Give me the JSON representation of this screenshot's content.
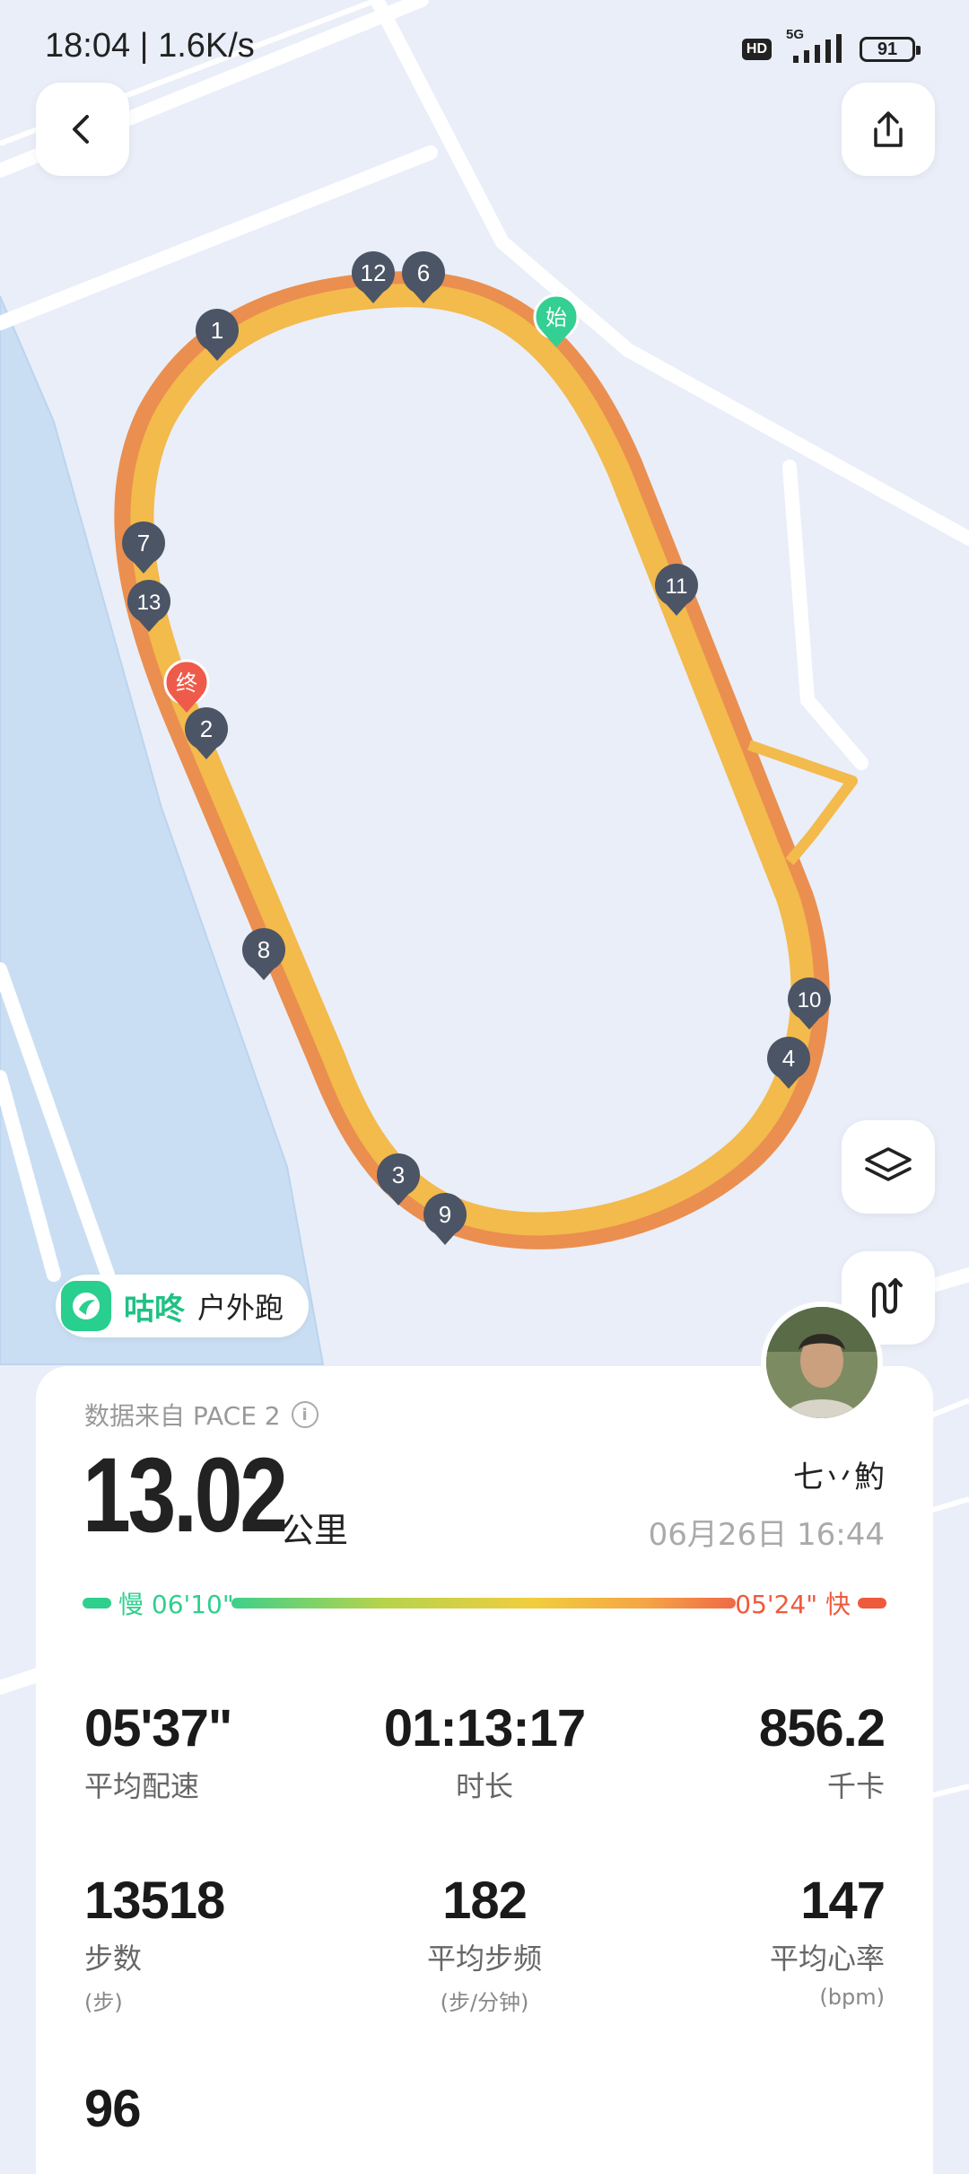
{
  "status_bar": {
    "time": "18:04 | 1.6K/s",
    "hd": "HD",
    "network": "5G",
    "battery": "91"
  },
  "map": {
    "start_label": "始",
    "end_label": "终",
    "km_markers": [
      "1",
      "2",
      "3",
      "4",
      "6",
      "7",
      "8",
      "9",
      "10",
      "11",
      "12",
      "13"
    ]
  },
  "brand": {
    "name": "咕咚",
    "activity_type": "户外跑"
  },
  "summary": {
    "source": "数据来自 PACE 2",
    "distance": "13.02",
    "distance_unit": "公里",
    "user_name": "七丷魡",
    "date": "06月26日 16:44",
    "pace_slow": "慢 06'10\"",
    "pace_fast": "05'24\" 快"
  },
  "metrics": {
    "avg_pace": {
      "value": "05'37\"",
      "label": "平均配速"
    },
    "duration": {
      "value": "01:13:17",
      "label": "时长"
    },
    "calories": {
      "value": "856.2",
      "label": "千卡"
    },
    "steps": {
      "value": "13518",
      "label": "步数",
      "unit": "(步)"
    },
    "cadence": {
      "value": "182",
      "label": "平均步频",
      "unit": "(步/分钟)"
    },
    "heart_rate": {
      "value": "147",
      "label": "平均心率",
      "unit": "(bpm)"
    },
    "extra": {
      "value": "96"
    }
  },
  "icons": {
    "back": "back-arrow-icon",
    "share": "share-icon",
    "layers": "layers-icon",
    "route_replay": "route-replay-icon",
    "info": "info-icon"
  },
  "colors": {
    "track": "#f2b84a",
    "track_dark": "#ea8f50",
    "marker": "#4b5566",
    "start": "#34cf92",
    "end": "#ef5b4a",
    "brand": "#1fc185"
  }
}
